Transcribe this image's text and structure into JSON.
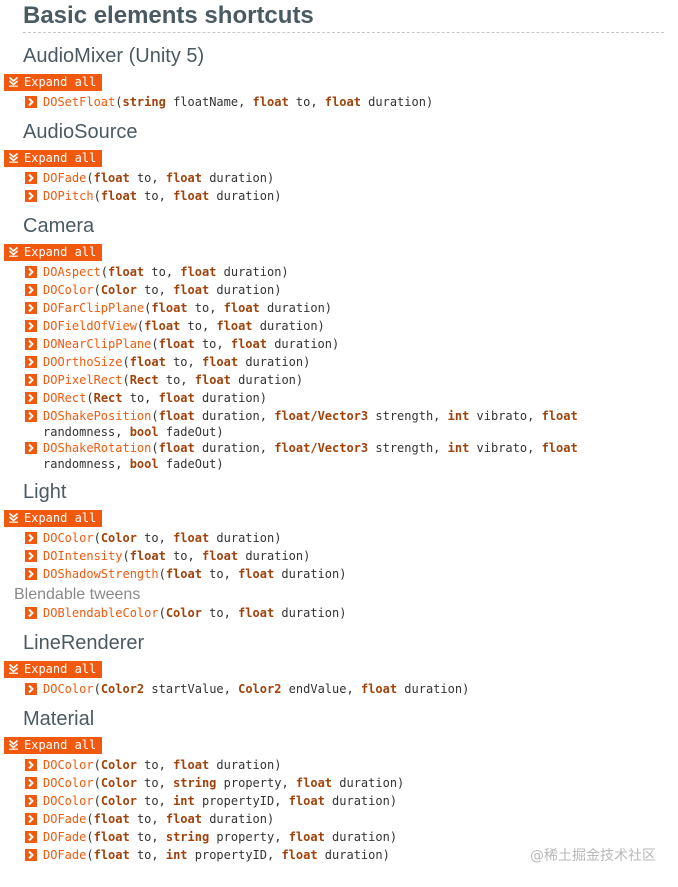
{
  "page_title": "Basic elements shortcuts",
  "expand_label": "Expand all",
  "watermark": "@稀土掘金技术社区",
  "colors": {
    "accent": "#f15a0e",
    "type": "#a0420a",
    "heading": "#4a5a63"
  },
  "sections": [
    {
      "title": "AudioMixer (Unity 5)",
      "has_expand": true,
      "methods": [
        [
          [
            "m",
            "DOSetFloat"
          ],
          [
            "p",
            "("
          ],
          [
            "t",
            "string"
          ],
          [
            "p",
            " floatName, "
          ],
          [
            "t",
            "float"
          ],
          [
            "p",
            " to, "
          ],
          [
            "t",
            "float"
          ],
          [
            "p",
            " duration)"
          ]
        ]
      ]
    },
    {
      "title": "AudioSource",
      "has_expand": true,
      "methods": [
        [
          [
            "m",
            "DOFade"
          ],
          [
            "p",
            "("
          ],
          [
            "t",
            "float"
          ],
          [
            "p",
            " to, "
          ],
          [
            "t",
            "float"
          ],
          [
            "p",
            " duration)"
          ]
        ],
        [
          [
            "m",
            "DOPitch"
          ],
          [
            "p",
            "("
          ],
          [
            "t",
            "float"
          ],
          [
            "p",
            " to, "
          ],
          [
            "t",
            "float"
          ],
          [
            "p",
            " duration)"
          ]
        ]
      ]
    },
    {
      "title": "Camera",
      "has_expand": true,
      "methods": [
        [
          [
            "m",
            "DOAspect"
          ],
          [
            "p",
            "("
          ],
          [
            "t",
            "float"
          ],
          [
            "p",
            " to, "
          ],
          [
            "t",
            "float"
          ],
          [
            "p",
            " duration)"
          ]
        ],
        [
          [
            "m",
            "DOColor"
          ],
          [
            "p",
            "("
          ],
          [
            "t",
            "Color"
          ],
          [
            "p",
            " to, "
          ],
          [
            "t",
            "float"
          ],
          [
            "p",
            " duration)"
          ]
        ],
        [
          [
            "m",
            "DOFarClipPlane"
          ],
          [
            "p",
            "("
          ],
          [
            "t",
            "float"
          ],
          [
            "p",
            " to, "
          ],
          [
            "t",
            "float"
          ],
          [
            "p",
            " duration)"
          ]
        ],
        [
          [
            "m",
            "DOFieldOfView"
          ],
          [
            "p",
            "("
          ],
          [
            "t",
            "float"
          ],
          [
            "p",
            " to, "
          ],
          [
            "t",
            "float"
          ],
          [
            "p",
            " duration)"
          ]
        ],
        [
          [
            "m",
            "DONearClipPlane"
          ],
          [
            "p",
            "("
          ],
          [
            "t",
            "float"
          ],
          [
            "p",
            " to, "
          ],
          [
            "t",
            "float"
          ],
          [
            "p",
            " duration)"
          ]
        ],
        [
          [
            "m",
            "DOOrthoSize"
          ],
          [
            "p",
            "("
          ],
          [
            "t",
            "float"
          ],
          [
            "p",
            " to, "
          ],
          [
            "t",
            "float"
          ],
          [
            "p",
            " duration)"
          ]
        ],
        [
          [
            "m",
            "DOPixelRect"
          ],
          [
            "p",
            "("
          ],
          [
            "t",
            "Rect"
          ],
          [
            "p",
            " to, "
          ],
          [
            "t",
            "float"
          ],
          [
            "p",
            " duration)"
          ]
        ],
        [
          [
            "m",
            "DORect"
          ],
          [
            "p",
            "("
          ],
          [
            "t",
            "Rect"
          ],
          [
            "p",
            " to, "
          ],
          [
            "t",
            "float"
          ],
          [
            "p",
            " duration)"
          ]
        ],
        [
          [
            "m",
            "DOShakePosition"
          ],
          [
            "p",
            "("
          ],
          [
            "t",
            "float"
          ],
          [
            "p",
            " duration, "
          ],
          [
            "t",
            "float/Vector3"
          ],
          [
            "p",
            " strength, "
          ],
          [
            "t",
            "int"
          ],
          [
            "p",
            " vibrato, "
          ],
          [
            "t",
            "float"
          ],
          [
            "p",
            " randomness, "
          ],
          [
            "t",
            "bool"
          ],
          [
            "p",
            " fadeOut)"
          ]
        ],
        [
          [
            "m",
            "DOShakeRotation"
          ],
          [
            "p",
            "("
          ],
          [
            "t",
            "float"
          ],
          [
            "p",
            " duration, "
          ],
          [
            "t",
            "float/Vector3"
          ],
          [
            "p",
            " strength, "
          ],
          [
            "t",
            "int"
          ],
          [
            "p",
            " vibrato, "
          ],
          [
            "t",
            "float"
          ],
          [
            "p",
            " randomness, "
          ],
          [
            "t",
            "bool"
          ],
          [
            "p",
            " fadeOut)"
          ]
        ]
      ]
    },
    {
      "title": "Light",
      "has_expand": true,
      "methods": [
        [
          [
            "m",
            "DOColor"
          ],
          [
            "p",
            "("
          ],
          [
            "t",
            "Color"
          ],
          [
            "p",
            " to, "
          ],
          [
            "t",
            "float"
          ],
          [
            "p",
            " duration)"
          ]
        ],
        [
          [
            "m",
            "DOIntensity"
          ],
          [
            "p",
            "("
          ],
          [
            "t",
            "float"
          ],
          [
            "p",
            " to, "
          ],
          [
            "t",
            "float"
          ],
          [
            "p",
            " duration)"
          ]
        ],
        [
          [
            "m",
            "DOShadowStrength"
          ],
          [
            "p",
            "("
          ],
          [
            "t",
            "float"
          ],
          [
            "p",
            " to, "
          ],
          [
            "t",
            "float"
          ],
          [
            "p",
            " duration)"
          ]
        ]
      ],
      "subsections": [
        {
          "title": "Blendable tweens",
          "methods": [
            [
              [
                "m",
                "DOBlendableColor"
              ],
              [
                "p",
                "("
              ],
              [
                "t",
                "Color"
              ],
              [
                "p",
                " to, "
              ],
              [
                "t",
                "float"
              ],
              [
                "p",
                " duration)"
              ]
            ]
          ]
        }
      ]
    },
    {
      "title": "LineRenderer",
      "has_expand": true,
      "methods": [
        [
          [
            "m",
            "DOColor"
          ],
          [
            "p",
            "("
          ],
          [
            "t",
            "Color2"
          ],
          [
            "p",
            " startValue, "
          ],
          [
            "t",
            "Color2"
          ],
          [
            "p",
            " endValue, "
          ],
          [
            "t",
            "float"
          ],
          [
            "p",
            " duration)"
          ]
        ]
      ]
    },
    {
      "title": "Material",
      "has_expand": true,
      "methods": [
        [
          [
            "m",
            "DOColor"
          ],
          [
            "p",
            "("
          ],
          [
            "t",
            "Color"
          ],
          [
            "p",
            " to, "
          ],
          [
            "t",
            "float"
          ],
          [
            "p",
            " duration)"
          ]
        ],
        [
          [
            "m",
            "DOColor"
          ],
          [
            "p",
            "("
          ],
          [
            "t",
            "Color"
          ],
          [
            "p",
            " to, "
          ],
          [
            "t",
            "string"
          ],
          [
            "p",
            " property, "
          ],
          [
            "t",
            "float"
          ],
          [
            "p",
            " duration)"
          ]
        ],
        [
          [
            "m",
            "DOColor"
          ],
          [
            "p",
            "("
          ],
          [
            "t",
            "Color"
          ],
          [
            "p",
            " to, "
          ],
          [
            "t",
            "int"
          ],
          [
            "p",
            " propertyID, "
          ],
          [
            "t",
            "float"
          ],
          [
            "p",
            " duration)"
          ]
        ],
        [
          [
            "m",
            "DOFade"
          ],
          [
            "p",
            "("
          ],
          [
            "t",
            "float"
          ],
          [
            "p",
            " to, "
          ],
          [
            "t",
            "float"
          ],
          [
            "p",
            " duration)"
          ]
        ],
        [
          [
            "m",
            "DOFade"
          ],
          [
            "p",
            "("
          ],
          [
            "t",
            "float"
          ],
          [
            "p",
            " to, "
          ],
          [
            "t",
            "string"
          ],
          [
            "p",
            " property, "
          ],
          [
            "t",
            "float"
          ],
          [
            "p",
            " duration)"
          ]
        ],
        [
          [
            "m",
            "DOFade"
          ],
          [
            "p",
            "("
          ],
          [
            "t",
            "float"
          ],
          [
            "p",
            " to, "
          ],
          [
            "t",
            "int"
          ],
          [
            "p",
            " propertyID, "
          ],
          [
            "t",
            "float"
          ],
          [
            "p",
            " duration)"
          ]
        ]
      ]
    }
  ]
}
